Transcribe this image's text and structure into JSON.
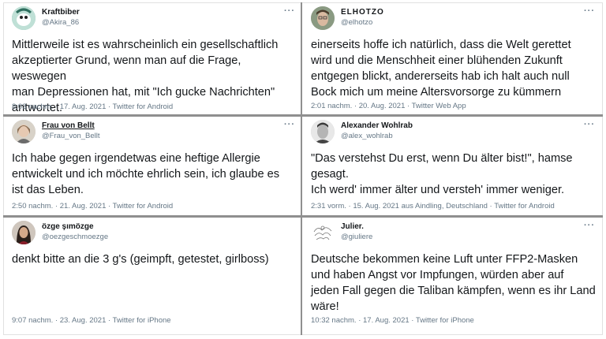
{
  "tweets": [
    {
      "name": "Kraftbiber",
      "handle": "@Akira_86",
      "text": "Mittlerweile ist es wahrscheinlich ein gesellschaftlich\nakzeptierter Grund, wenn man auf die Frage, weswegen\nman Depressionen hat, mit \"Ich gucke Nachrichten\"\nantwortet.",
      "meta": "8:03 nachm. · 17. Aug. 2021 · Twitter for Android"
    },
    {
      "name": "ELHOTZO",
      "handle": "@elhotzo",
      "text": "einerseits hoffe ich natürlich, dass die Welt gerettet\nwird und die Menschheit einer blühenden Zukunft\nentgegen blickt, andererseits hab ich halt auch null\nBock mich um meine Altersvorsorge zu kümmern",
      "meta": "2:01 nachm. · 20. Aug. 2021 · Twitter Web App"
    },
    {
      "name": "Frau von Bellt",
      "handle": "@Frau_von_Bellt",
      "text": "Ich habe gegen irgendetwas eine heftige Allergie\nentwickelt und ich möchte ehrlich sein, ich glaube es\nist das Leben.",
      "meta": "2:50 nachm. · 21. Aug. 2021 · Twitter for Android"
    },
    {
      "name": "Alexander Wohlrab",
      "handle": "@alex_wohlrab",
      "text": "\"Das verstehst Du erst, wenn Du älter bist!\", hamse\ngesagt.\nIch werd' immer älter und versteh' immer weniger.",
      "meta": "2:31 vorm. · 15. Aug. 2021 aus Aindling, Deutschland · Twitter for Android"
    },
    {
      "name": "özge şımözge",
      "handle": "@oezgeschmoezge",
      "text": "denkt bitte an die 3 g's (geimpft, getestet, girlboss)",
      "meta": "9:07 nachm. · 23. Aug. 2021 · Twitter for iPhone"
    },
    {
      "name": "Julier.",
      "handle": "@giuliere",
      "text": "Deutsche bekommen keine Luft unter  FFP2-Masken\nund haben Angst vor Impfungen, würden aber auf\njeden Fall gegen die Taliban kämpfen, wenn es ihr Land\nwäre!",
      "meta": "10:32 nachm. · 17. Aug. 2021 · Twitter for iPhone"
    }
  ],
  "more_label": "···",
  "colors": {
    "text": "#14171a",
    "secondary": "#657786",
    "divider": "#8f8f8f"
  }
}
